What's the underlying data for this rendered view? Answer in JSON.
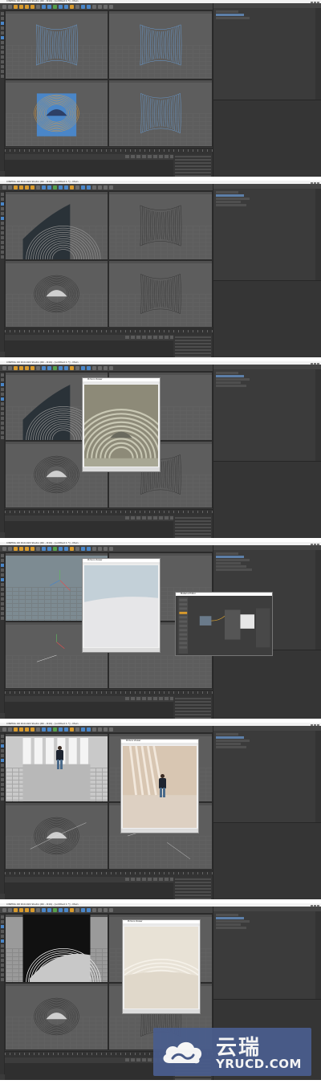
{
  "app": {
    "titlebar_text": "CINEMA 4D R19.024 Studio (RC - R19) - [untitled 1 *] - Main"
  },
  "frames": [
    {
      "id": "frame-1",
      "viewport_labels": [
        "",
        "",
        "",
        ""
      ]
    },
    {
      "id": "frame-2",
      "viewport_labels": [
        "",
        "",
        "",
        ""
      ]
    },
    {
      "id": "frame-3",
      "viewport_labels": [
        "",
        "",
        "",
        ""
      ]
    },
    {
      "id": "frame-4",
      "viewport_labels": [
        "",
        "",
        "",
        ""
      ]
    },
    {
      "id": "frame-5",
      "viewport_labels": [
        "",
        "",
        "",
        ""
      ]
    },
    {
      "id": "frame-6",
      "viewport_labels": [
        "",
        "",
        "",
        ""
      ]
    }
  ],
  "render_window_title": "Picture Viewer",
  "material_editor_title": "Material Editor",
  "watermark": {
    "zh": "云瑞",
    "en": "YRUCD.COM"
  },
  "colors": {
    "accent_orange": "#d89a2c",
    "accent_blue": "#4a86c8",
    "wire_blue": "#6aa8e8",
    "wire_orange": "#f0a030",
    "watermark_bg": "#4a5d8c"
  }
}
